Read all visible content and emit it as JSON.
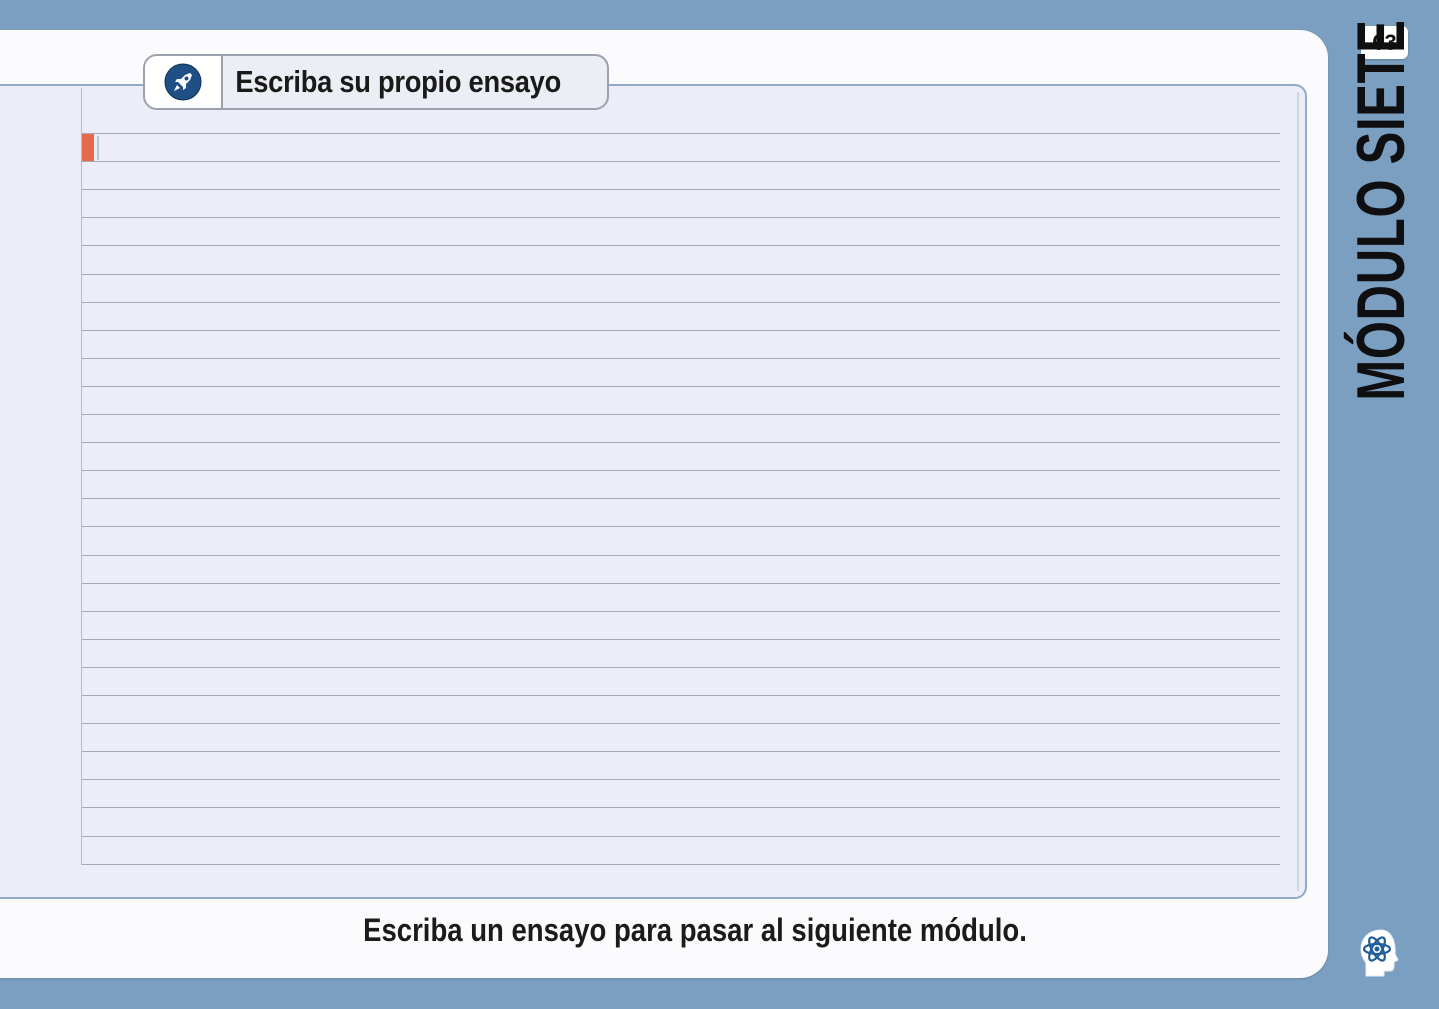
{
  "page": {
    "page_number": "63",
    "module_title": "MÓDULO SIETE"
  },
  "section": {
    "title": "Escriba su propio ensayo",
    "icon": "rocket-icon"
  },
  "footer": {
    "instruction": "Escriba un ensayo para pasar al siguiente módulo."
  },
  "essay": {
    "text": ""
  },
  "colors": {
    "background": "#7a9fc0",
    "panel": "#ecedf7",
    "accent": "#e8694a",
    "icon_circle": "#1f4f84"
  }
}
